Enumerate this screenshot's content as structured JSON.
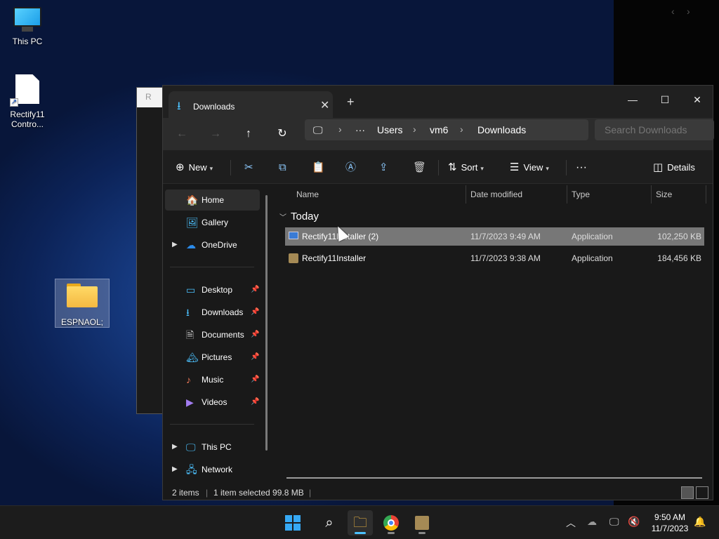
{
  "desktop": {
    "icons": [
      {
        "label": "This PC"
      },
      {
        "label": "Rectify11 Contro..."
      },
      {
        "label": "ESPNAOL;"
      }
    ],
    "bg_window_title": "R"
  },
  "explorer": {
    "tab_title": "Downloads",
    "breadcrumb": {
      "more": "···",
      "items": [
        "Users",
        "vm6",
        "Downloads"
      ]
    },
    "search_placeholder": "Search Downloads",
    "commands": {
      "new": "New",
      "sort": "Sort",
      "view": "View",
      "more": "···",
      "details": "Details"
    },
    "nav": {
      "home": "Home",
      "gallery": "Gallery",
      "onedrive": "OneDrive",
      "quick_access": [
        {
          "label": "Desktop"
        },
        {
          "label": "Downloads"
        },
        {
          "label": "Documents"
        },
        {
          "label": "Pictures"
        },
        {
          "label": "Music"
        },
        {
          "label": "Videos"
        }
      ],
      "this_pc": "This PC",
      "network": "Network"
    },
    "columns": {
      "name": "Name",
      "date": "Date modified",
      "type": "Type",
      "size": "Size"
    },
    "group": "Today",
    "files": [
      {
        "name": "Rectify11Installer (2)",
        "date": "11/7/2023 9:49 AM",
        "type": "Application",
        "size": "102,250 KB"
      },
      {
        "name": "Rectify11Installer",
        "date": "11/7/2023 9:38 AM",
        "type": "Application",
        "size": "184,456 KB"
      }
    ],
    "status": {
      "count": "2 items",
      "selection": "1 item selected  99.8 MB"
    }
  },
  "taskbar": {
    "time": "9:50 AM",
    "date": "11/7/2023"
  },
  "colors": {
    "accent": "#4cc2ff",
    "selection": "#777777",
    "explorer_bg": "#191919"
  }
}
